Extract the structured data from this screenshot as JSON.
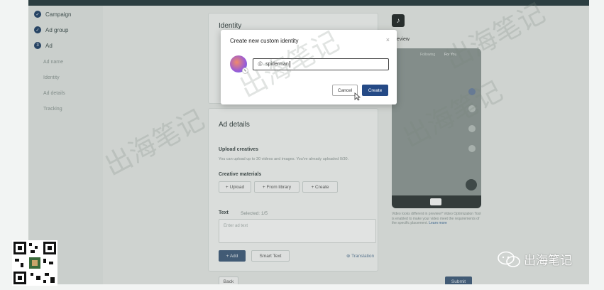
{
  "nav": {
    "steps": [
      {
        "label": "Campaign",
        "icon": "check-icon"
      },
      {
        "label": "Ad group",
        "icon": "check-icon"
      },
      {
        "label": "Ad",
        "number": "3"
      }
    ],
    "sub_items": [
      "Ad name",
      "Identity",
      "Ad details",
      "Tracking"
    ]
  },
  "identity": {
    "heading": "Identity"
  },
  "ad_details": {
    "heading": "Ad details",
    "upload_label": "Upload creatives",
    "upload_hint": "You can upload up to 30 videos and images. You've already uploaded 0/30.",
    "materials_label": "Creative materials",
    "buttons": [
      "+ Upload",
      "+ From library",
      "+ Create"
    ],
    "text_label": "Text",
    "selected": "Selected: 1/5",
    "text_placeholder": "Enter ad text",
    "add_button": "+ Add",
    "smart_text": "Smart Text",
    "translation": "Translation"
  },
  "preview": {
    "tab": "Preview",
    "following": "Following",
    "for_you": "For You",
    "note": "Video looks different in preview? Video Optimization Tool is enabled to make your video meet the requirements of the specific placement.",
    "learn_more": "Learn more"
  },
  "footer": {
    "back": "Back",
    "submit": "Submit"
  },
  "modal": {
    "title": "Create new custom identity",
    "close": "×",
    "input_prefix": "@",
    "input_value": "spiderman",
    "cancel": "Cancel",
    "create": "Create"
  },
  "watermark": {
    "text": "出海笔记",
    "brand": "出海笔记"
  }
}
